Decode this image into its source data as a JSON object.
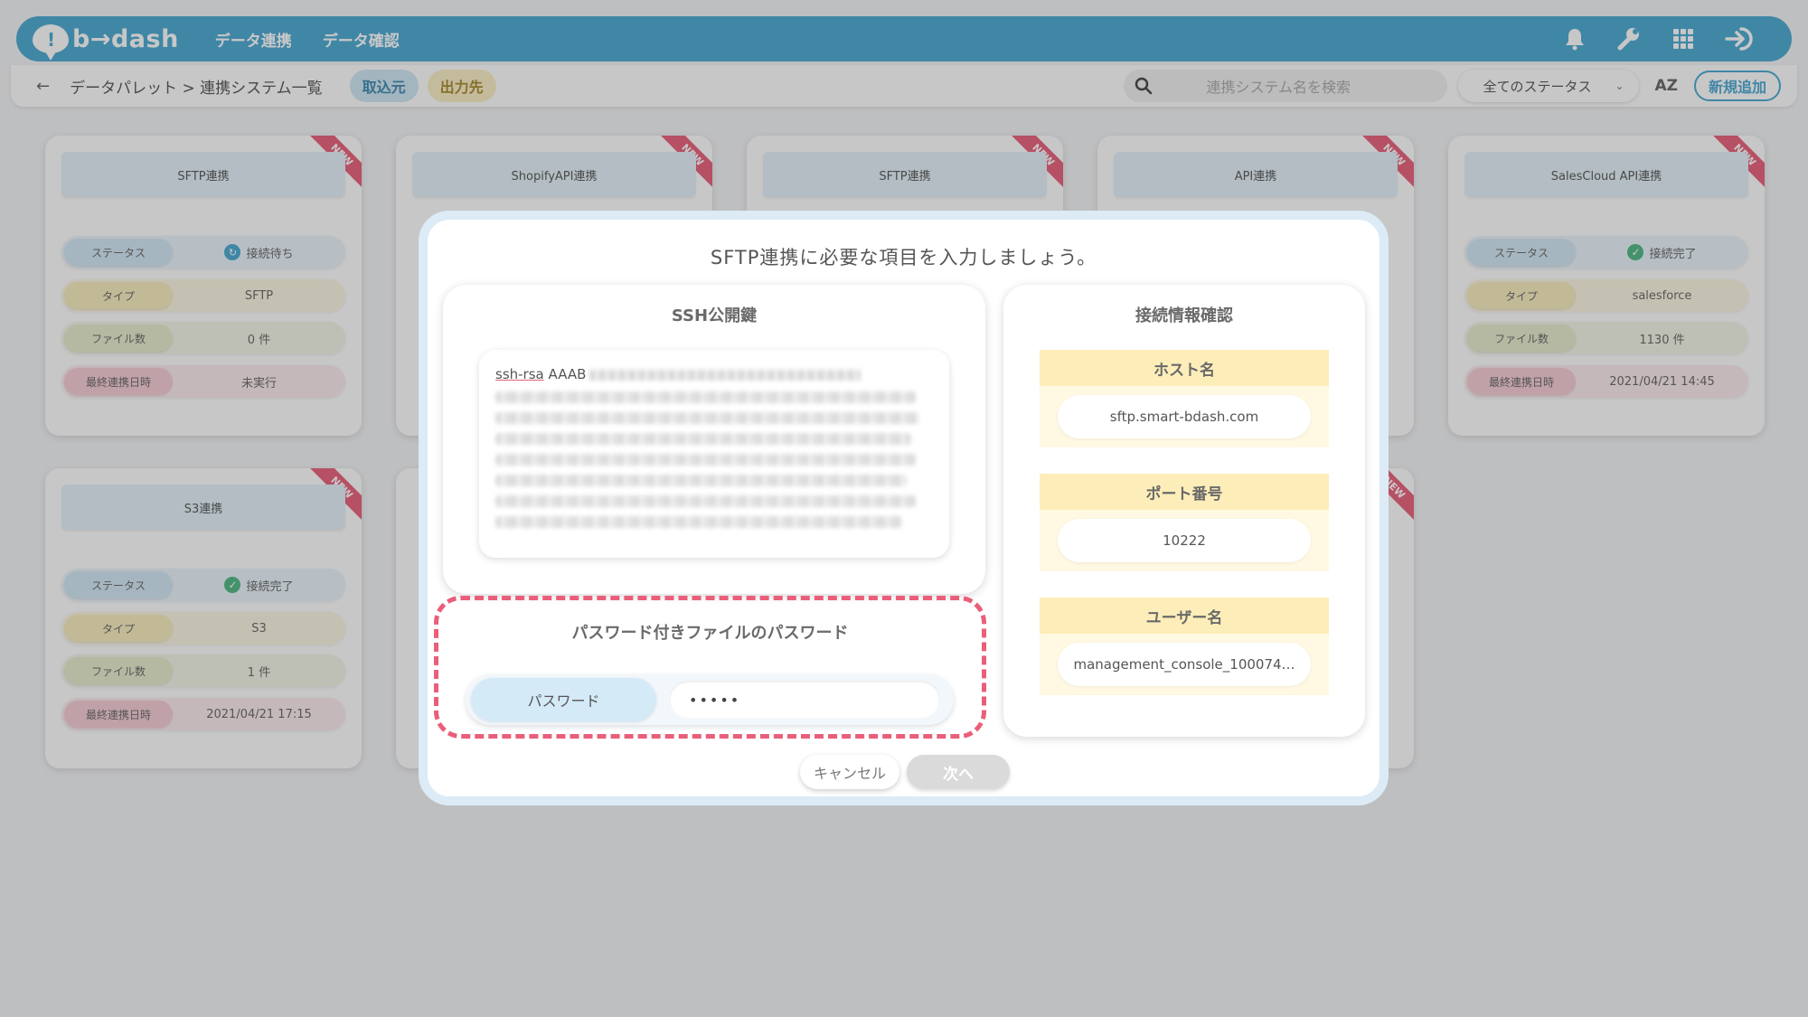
{
  "header": {
    "logo_text": "b→dash",
    "nav": [
      "データ連携",
      "データ確認"
    ]
  },
  "subbar": {
    "breadcrumb": "データパレット > 連携システム一覧",
    "tab_source": "取込元",
    "tab_destination": "出力先",
    "search_placeholder": "連携システム名を検索",
    "status_filter": "全てのステータス",
    "sort_label": "AZ",
    "new_button": "新規追加"
  },
  "labels": {
    "status": "ステータス",
    "type": "タイプ",
    "files": "ファイル数",
    "last_sync": "最終連携日時",
    "new_badge": "NEW"
  },
  "cards": [
    {
      "title": "SFTP連携",
      "status": "接続待ち",
      "type": "SFTP",
      "files": "0 件",
      "last_sync": "未実行"
    },
    {
      "title": "ShopifyAPI連携"
    },
    {
      "title": "SFTP連携"
    },
    {
      "title": "API連携"
    },
    {
      "title": "SalesCloud API連携",
      "status": "接続完了",
      "type": "salesforce",
      "files": "1130 件",
      "last_sync": "2021/04/21 14:45"
    },
    {
      "title": "S3連携",
      "status": "接続完了",
      "type": "S3",
      "files": "1 件",
      "last_sync": "2021/04/21 17:15"
    }
  ],
  "modal": {
    "title": "SFTP連携に必要な項目を入力しましょう。",
    "ssh_section_title": "SSH公開鍵",
    "ssh_key_prefix": "ssh-rsa",
    "ssh_key_start": "AAAB",
    "password_section_title": "パスワード付きファイルのパスワード",
    "password_label": "パスワード",
    "password_value": "•••••",
    "connection_section_title": "接続情報確認",
    "host_label": "ホスト名",
    "host_value": "sftp.smart-bdash.com",
    "port_label": "ポート番号",
    "port_value": "10222",
    "user_label": "ユーザー名",
    "user_value": "management_console_100074…",
    "cancel_button": "キャンセル",
    "next_button": "次へ"
  },
  "colors": {
    "brand": "#4aa9d3",
    "accent_pink": "#e95f7a",
    "status_ok": "#4db884"
  }
}
